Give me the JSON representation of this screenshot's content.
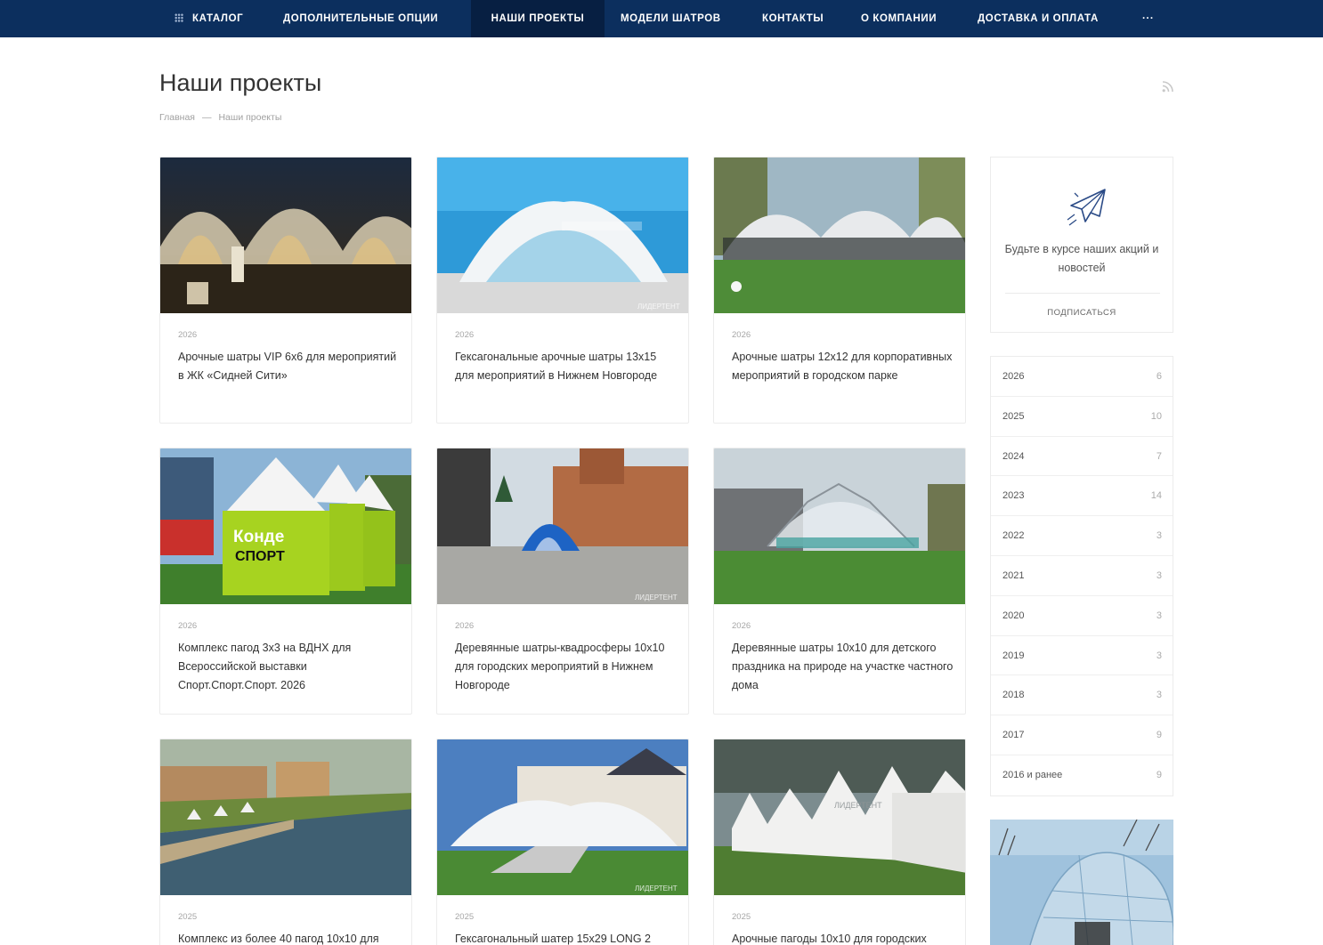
{
  "nav": {
    "items": [
      {
        "label": "Каталог"
      },
      {
        "label": "Дополнительные опции"
      },
      {
        "label": "Наши проекты"
      },
      {
        "label": "Модели шатров"
      },
      {
        "label": "Контакты"
      },
      {
        "label": "О компании"
      },
      {
        "label": "Доставка и оплата"
      },
      {
        "label": "···"
      }
    ],
    "active_index": 2,
    "colors": {
      "bar": "#0c2f5e",
      "active": "#071f42"
    }
  },
  "page": {
    "title": "Наши проекты",
    "breadcrumb": [
      "Главная",
      "—",
      "Наши проекты"
    ]
  },
  "projects": [
    {
      "year": "2026",
      "title": "Арочные шатры VIP 6х6 для мероприятий в ЖК «Сидней Сити»"
    },
    {
      "year": "2026",
      "title": "Гексагональные арочные шатры 13х15 для мероприятий в Нижнем Новгороде"
    },
    {
      "year": "2026",
      "title": "Арочные шатры 12х12 для корпоративных мероприятий в городском парке"
    },
    {
      "year": "2026",
      "title": "Комплекс пагод 3х3 на ВДНХ для Всероссийской выставки Спорт.Спорт.Спорт. 2026"
    },
    {
      "year": "2026",
      "title": "Деревянные шатры-квадросферы 10х10 для городских мероприятий в Нижнем Новгороде"
    },
    {
      "year": "2026",
      "title": "Деревянные шатры 10х10 для детского праздника на природе на участке частного дома"
    },
    {
      "year": "2025",
      "title": "Комплекс из более 40 пагод 10х10 для"
    },
    {
      "year": "2025",
      "title": "Гексагональный шатер 15х29 LONG 2"
    },
    {
      "year": "2025",
      "title": "Арочные пагоды 10х10 для городских"
    }
  ],
  "subscribe": {
    "text": "Будьте в курсе наших акций и новостей",
    "link": "Подписаться",
    "icon": "paper-plane-icon"
  },
  "years": [
    {
      "label": "2026",
      "count": "6"
    },
    {
      "label": "2025",
      "count": "10"
    },
    {
      "label": "2024",
      "count": "7"
    },
    {
      "label": "2023",
      "count": "14"
    },
    {
      "label": "2022",
      "count": "3"
    },
    {
      "label": "2021",
      "count": "3"
    },
    {
      "label": "2020",
      "count": "3"
    },
    {
      "label": "2019",
      "count": "3"
    },
    {
      "label": "2018",
      "count": "3"
    },
    {
      "label": "2017",
      "count": "9"
    },
    {
      "label": "2016 и ранее",
      "count": "9"
    }
  ],
  "photo_texts": {
    "watermark": "ЛИДЕРТЕНТ",
    "banner_brand": "Конде",
    "banner_word": "СПОРТ"
  }
}
